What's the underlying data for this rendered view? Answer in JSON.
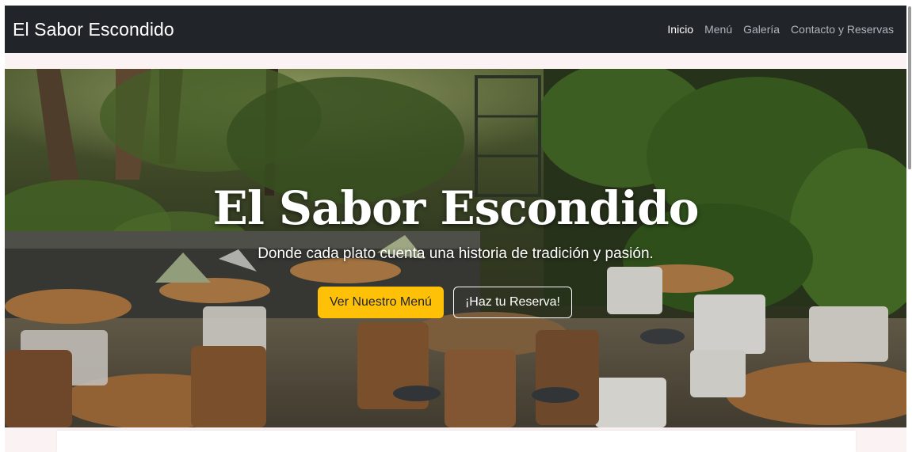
{
  "navbar": {
    "brand": "El Sabor Escondido",
    "links": [
      {
        "label": "Inicio",
        "active": true
      },
      {
        "label": "Menú",
        "active": false
      },
      {
        "label": "Galería",
        "active": false
      },
      {
        "label": "Contacto y Reservas",
        "active": false
      }
    ]
  },
  "hero": {
    "title": "El Sabor Escondido",
    "subtitle": "Donde cada plato cuenta una historia de tradición y pasión.",
    "primary_button": "Ver Nuestro Menú",
    "secondary_button": "¡Haz tu Reserva!"
  },
  "colors": {
    "navbar_bg": "#212529",
    "accent": "#ffc107",
    "page_tint": "#fbf3f3"
  }
}
